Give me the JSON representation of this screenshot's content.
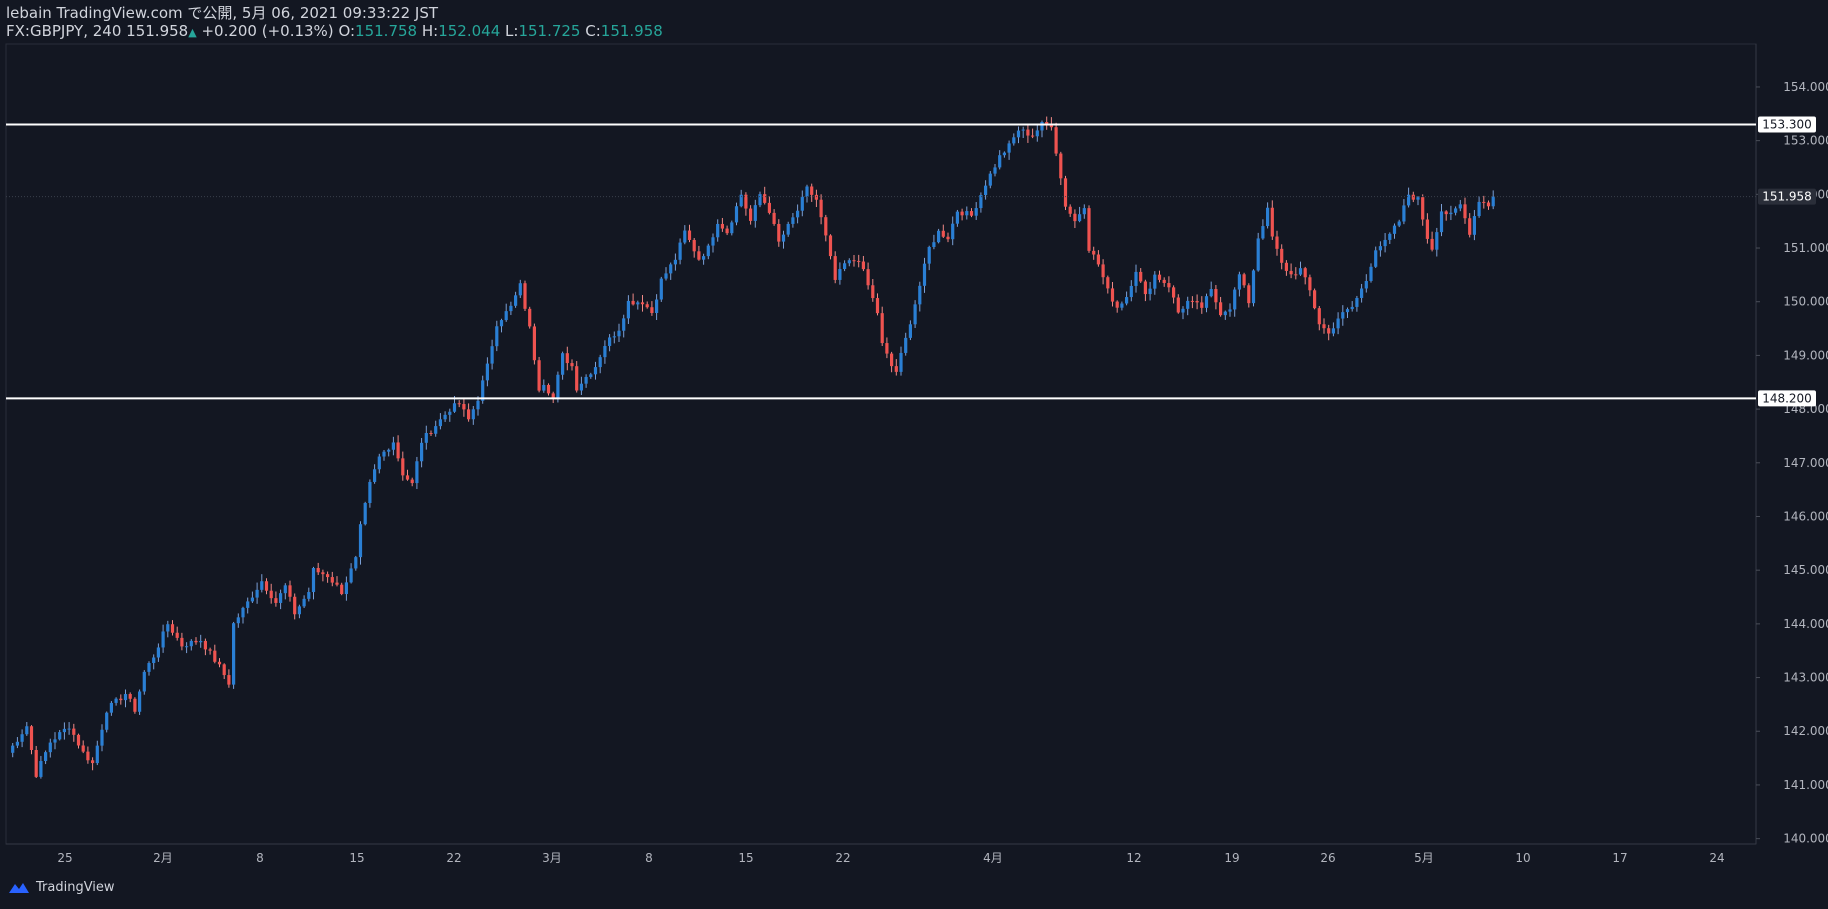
{
  "header": {
    "line1": "lebain TradingView.com で公開, 5月 06, 2021 09:33:22 JST",
    "symbol": "FX:GBPJPY, 240",
    "last": "151.958",
    "change": "+0.200 (+0.13%)",
    "o_label": "O:",
    "o_value": "151.758",
    "h_label": "H:",
    "h_value": "152.044",
    "l_label": "L:",
    "l_value": "151.725",
    "c_label": "C:",
    "c_value": "151.958"
  },
  "footer": {
    "brand": "TradingView"
  },
  "colors": {
    "background": "#131722",
    "up": "#2a7fd4",
    "down": "#ef5350",
    "grid": "#1e222d",
    "axis_text": "#b2b5be",
    "level_line": "#ffffff"
  },
  "chart_data": {
    "type": "candlestick",
    "symbol": "FX:GBPJPY",
    "interval": "240",
    "ylim": [
      139.9,
      154.8
    ],
    "y_ticks": [
      140,
      141,
      142,
      143,
      144,
      145,
      146,
      147,
      148,
      149,
      150,
      151,
      152,
      153,
      154
    ],
    "y_tick_labels": [
      "140.000",
      "141.000",
      "142.000",
      "143.000",
      "144.000",
      "145.000",
      "146.000",
      "147.000",
      "148.000",
      "149.000",
      "150.000",
      "151.000",
      "152.000",
      "153.000",
      "154.000"
    ],
    "x_tick_labels": [
      "25",
      "2月",
      "8",
      "15",
      "22",
      "3月",
      "8",
      "15",
      "22",
      "4月",
      "12",
      "19",
      "26",
      "5月",
      "10",
      "17",
      "24"
    ],
    "horizontal_levels": [
      153.3,
      148.2
    ],
    "horizontal_level_labels": [
      "153.300",
      "148.200"
    ],
    "current_price": 151.958,
    "current_price_label": "151.958",
    "close_path": [
      [
        0,
        141.6
      ],
      [
        4,
        142.1
      ],
      [
        6,
        141.2
      ],
      [
        9,
        141.8
      ],
      [
        13,
        142.1
      ],
      [
        16,
        141.6
      ],
      [
        18,
        141.4
      ],
      [
        21,
        142.4
      ],
      [
        25,
        142.7
      ],
      [
        27,
        142.4
      ],
      [
        29,
        143.1
      ],
      [
        31,
        143.4
      ],
      [
        34,
        144.0
      ],
      [
        37,
        143.6
      ],
      [
        41,
        143.7
      ],
      [
        45,
        143.2
      ],
      [
        47,
        142.9
      ],
      [
        48,
        144.0
      ],
      [
        51,
        144.4
      ],
      [
        54,
        144.8
      ],
      [
        57,
        144.4
      ],
      [
        59,
        144.7
      ],
      [
        61,
        144.2
      ],
      [
        64,
        144.6
      ],
      [
        65,
        145.0
      ],
      [
        68,
        144.9
      ],
      [
        71,
        144.6
      ],
      [
        74,
        145.2
      ],
      [
        75,
        145.8
      ],
      [
        77,
        146.6
      ],
      [
        79,
        147.1
      ],
      [
        82,
        147.4
      ],
      [
        84,
        146.8
      ],
      [
        86,
        146.6
      ],
      [
        88,
        147.4
      ],
      [
        91,
        147.7
      ],
      [
        94,
        148.0
      ],
      [
        96,
        148.1
      ],
      [
        98,
        147.8
      ],
      [
        100,
        148.2
      ],
      [
        102,
        148.8
      ],
      [
        104,
        149.6
      ],
      [
        107,
        149.9
      ],
      [
        109,
        150.3
      ],
      [
        111,
        149.5
      ],
      [
        113,
        148.4
      ],
      [
        114,
        148.5
      ],
      [
        116,
        148.2
      ],
      [
        118,
        149.0
      ],
      [
        120,
        148.8
      ],
      [
        121,
        148.4
      ],
      [
        123,
        148.6
      ],
      [
        125,
        148.8
      ],
      [
        127,
        149.2
      ],
      [
        130,
        149.5
      ],
      [
        132,
        150.0
      ],
      [
        135,
        150.0
      ],
      [
        137,
        149.8
      ],
      [
        139,
        150.4
      ],
      [
        142,
        150.8
      ],
      [
        144,
        151.3
      ],
      [
        147,
        150.8
      ],
      [
        149,
        151.0
      ],
      [
        151,
        151.5
      ],
      [
        153,
        151.3
      ],
      [
        156,
        152.0
      ],
      [
        158,
        151.5
      ],
      [
        160,
        152.0
      ],
      [
        162,
        151.7
      ],
      [
        164,
        151.1
      ],
      [
        166,
        151.4
      ],
      [
        168,
        151.7
      ],
      [
        170,
        152.1
      ],
      [
        172,
        151.9
      ],
      [
        174,
        151.2
      ],
      [
        176,
        150.4
      ],
      [
        178,
        150.7
      ],
      [
        181,
        150.8
      ],
      [
        183,
        150.3
      ],
      [
        185,
        149.8
      ],
      [
        186,
        149.2
      ],
      [
        188,
        148.8
      ],
      [
        189,
        148.7
      ],
      [
        191,
        149.3
      ],
      [
        194,
        150.3
      ],
      [
        196,
        151.0
      ],
      [
        198,
        151.3
      ],
      [
        200,
        151.2
      ],
      [
        202,
        151.7
      ],
      [
        205,
        151.6
      ],
      [
        208,
        152.2
      ],
      [
        211,
        152.7
      ],
      [
        213,
        152.9
      ],
      [
        215,
        153.2
      ],
      [
        218,
        153.1
      ],
      [
        220,
        153.3
      ],
      [
        222,
        153.3
      ],
      [
        223,
        152.8
      ],
      [
        225,
        151.8
      ],
      [
        227,
        151.5
      ],
      [
        229,
        151.8
      ],
      [
        230,
        151.0
      ],
      [
        232,
        150.7
      ],
      [
        234,
        150.2
      ],
      [
        236,
        149.9
      ],
      [
        238,
        150.1
      ],
      [
        240,
        150.6
      ],
      [
        242,
        150.1
      ],
      [
        244,
        150.5
      ],
      [
        247,
        150.3
      ],
      [
        249,
        149.8
      ],
      [
        251,
        150.0
      ],
      [
        254,
        149.9
      ],
      [
        256,
        150.2
      ],
      [
        258,
        149.8
      ],
      [
        260,
        149.9
      ],
      [
        262,
        150.5
      ],
      [
        264,
        150.0
      ],
      [
        266,
        151.2
      ],
      [
        268,
        151.7
      ],
      [
        269,
        151.2
      ],
      [
        271,
        150.7
      ],
      [
        273,
        150.5
      ],
      [
        275,
        150.6
      ],
      [
        277,
        150.2
      ],
      [
        279,
        149.6
      ],
      [
        281,
        149.4
      ],
      [
        283,
        149.7
      ],
      [
        286,
        149.9
      ],
      [
        289,
        150.4
      ],
      [
        291,
        151.0
      ],
      [
        293,
        151.1
      ],
      [
        296,
        151.5
      ],
      [
        298,
        152.0
      ],
      [
        300,
        151.9
      ],
      [
        302,
        151.2
      ],
      [
        303,
        151.0
      ],
      [
        305,
        151.7
      ],
      [
        307,
        151.6
      ],
      [
        309,
        151.8
      ],
      [
        311,
        151.3
      ],
      [
        313,
        151.9
      ],
      [
        315,
        151.8
      ],
      [
        316,
        151.958
      ]
    ]
  }
}
